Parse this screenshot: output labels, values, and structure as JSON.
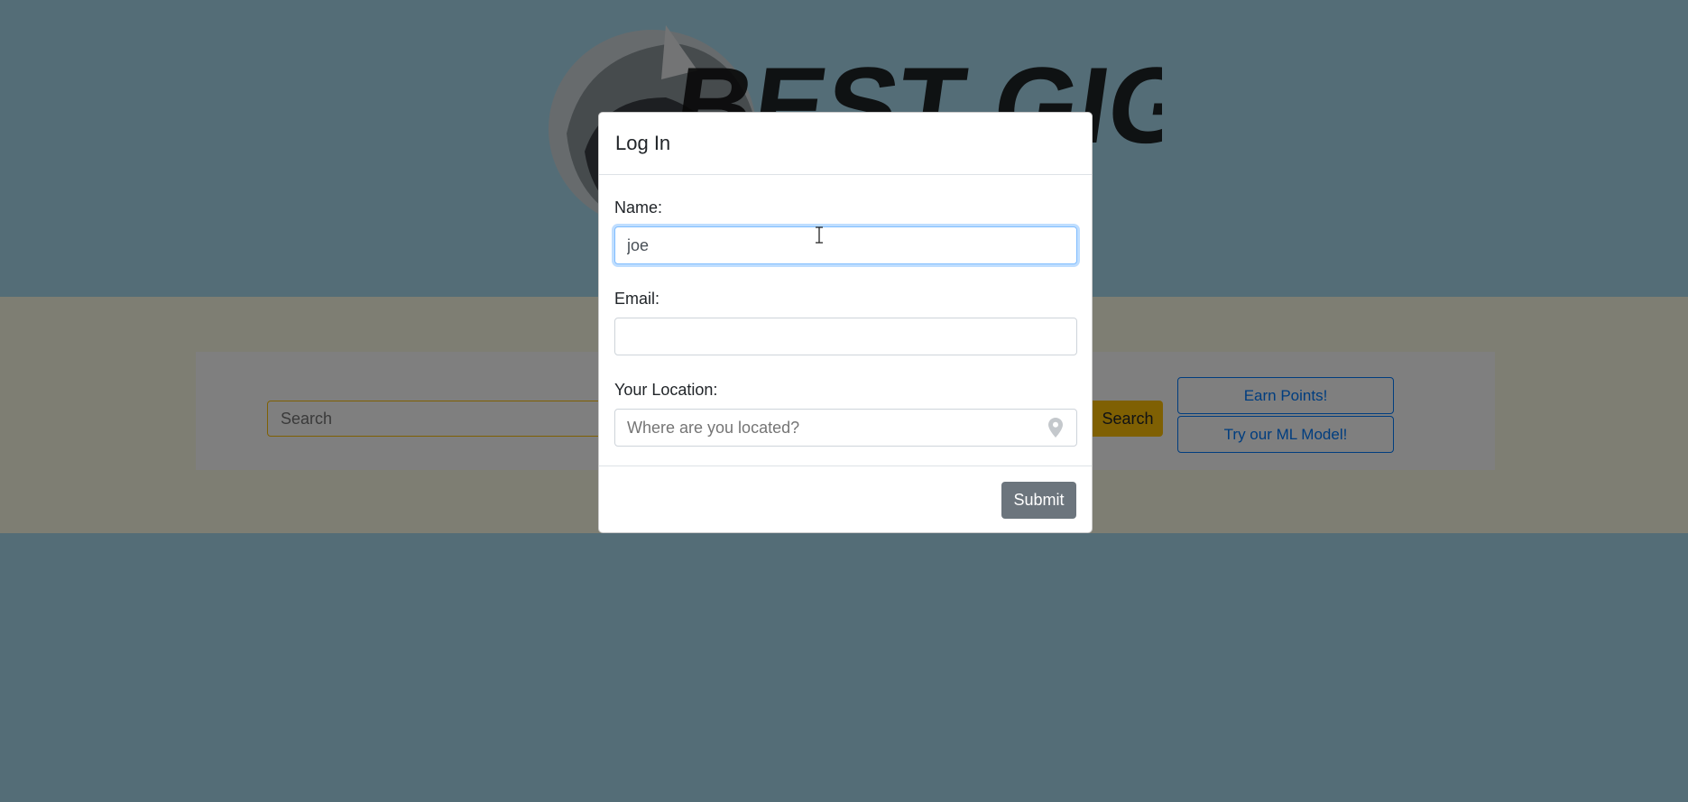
{
  "page": {
    "logo_text": "BEST GIG",
    "search": {
      "placeholder": "Search",
      "button_label": "Search"
    },
    "buttons": {
      "earn_points": "Earn Points!",
      "ml_model": "Try our ML Model!"
    }
  },
  "modal": {
    "title": "Log In",
    "name": {
      "label": "Name:",
      "value": "joe"
    },
    "email": {
      "label": "Email:",
      "value": ""
    },
    "location": {
      "label": "Your Location:",
      "placeholder": "Where are you located?",
      "icon": "map-pin-icon"
    },
    "submit_label": "Submit"
  },
  "colors": {
    "page_bg": "#a9dbef",
    "search_band_bg": "#fdfde6",
    "warning": "#ffc107",
    "primary": "#007bff",
    "secondary": "#6c757d"
  }
}
